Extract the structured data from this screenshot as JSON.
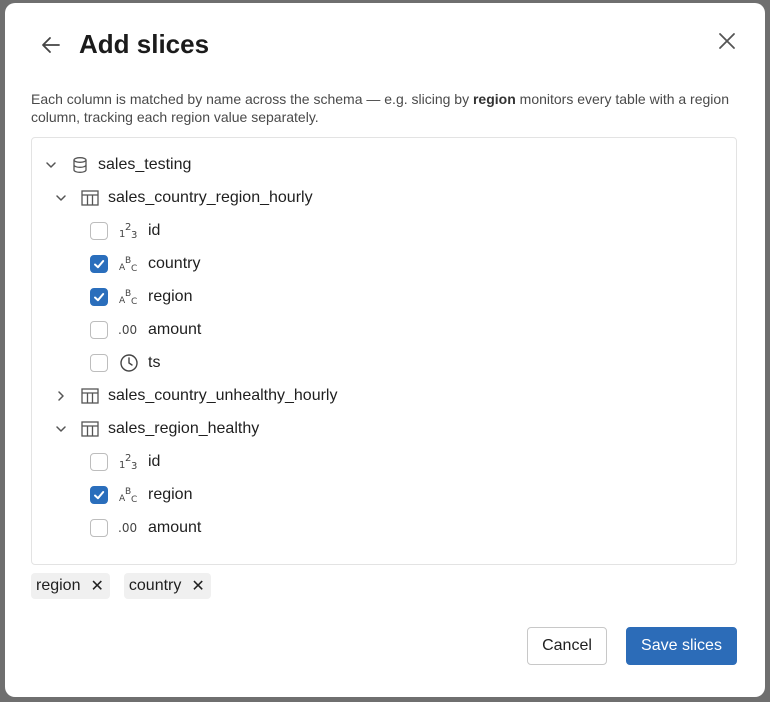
{
  "dialog": {
    "title": "Add slices",
    "description_prefix": "Each column is matched by name across the schema — e.g. slicing by ",
    "description_bold": "region",
    "description_suffix": " monitors every table with a region column, tracking each region value separately."
  },
  "tree": {
    "schema": {
      "name": "sales_testing",
      "icon": "database-icon",
      "expanded": true
    },
    "tables": [
      {
        "name": "sales_country_region_hourly",
        "expanded": true,
        "icon": "table-icon",
        "columns": [
          {
            "name": "id",
            "type_glyph": "123",
            "checked": false
          },
          {
            "name": "country",
            "type_glyph": "ABC",
            "checked": true
          },
          {
            "name": "region",
            "type_glyph": "ABC",
            "checked": true
          },
          {
            "name": "amount",
            "type_glyph": ".00",
            "checked": false
          },
          {
            "name": "ts",
            "type_glyph": "clock-icon",
            "checked": false
          }
        ]
      },
      {
        "name": "sales_country_unhealthy_hourly",
        "expanded": false,
        "icon": "table-icon",
        "columns": []
      },
      {
        "name": "sales_region_healthy",
        "expanded": true,
        "icon": "table-icon",
        "columns": [
          {
            "name": "id",
            "type_glyph": "123",
            "checked": false
          },
          {
            "name": "region",
            "type_glyph": "ABC",
            "checked": true
          },
          {
            "name": "amount",
            "type_glyph": ".00",
            "checked": false
          }
        ]
      }
    ]
  },
  "selected_chips": [
    {
      "label": "region",
      "remove": "✕"
    },
    {
      "label": "country",
      "remove": "✕"
    }
  ],
  "footer": {
    "cancel_label": "Cancel",
    "save_label": "Save slices"
  },
  "colors": {
    "primary": "#2c6cb8",
    "checkbox_checked": "#2a6ebc"
  }
}
